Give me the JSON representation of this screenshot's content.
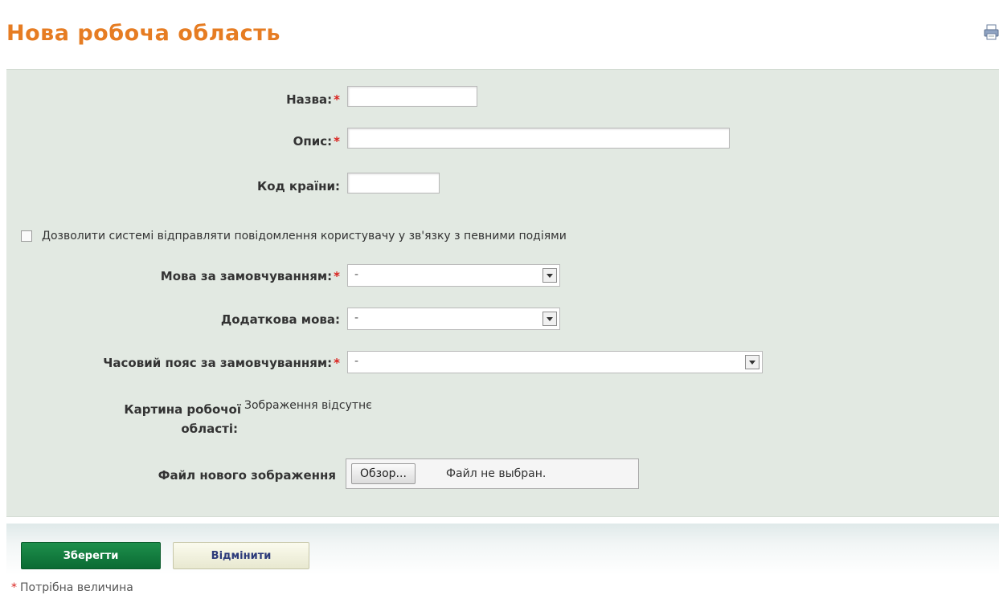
{
  "page": {
    "title": "Нова робоча область"
  },
  "form": {
    "name_label": "Назва:",
    "description_label": "Опис:",
    "country_code_label": "Код країни:",
    "notify_checkbox_label": "Дозволити системі відправляти повідомлення користувачу у зв'язку з певними подіями",
    "default_language_label": "Мова за замовчуванням:",
    "default_language_value": "-",
    "additional_language_label": "Додаткова мова:",
    "additional_language_value": "-",
    "timezone_label": "Часовий пояс за замовчуванням:",
    "timezone_value": "-",
    "workspace_image_label_line1": "Картина робочої",
    "workspace_image_label_line2": "області:",
    "workspace_image_status": "Зображення відсутнє",
    "new_image_file_label": "Файл нового зображення",
    "browse_button": "Обзор...",
    "file_status": "Файл не выбран."
  },
  "actions": {
    "save_label": "Зберегти",
    "cancel_label": "Відмінити"
  },
  "footnote": {
    "required_marker": "*",
    "required_text": "Потрібна величина"
  },
  "required_marker": "*",
  "icons": {
    "print": "print-icon"
  },
  "colors": {
    "title": "#e67c22",
    "panel": "#e2e9e2",
    "save_button": "#0b6b33",
    "required": "#d9211d"
  }
}
